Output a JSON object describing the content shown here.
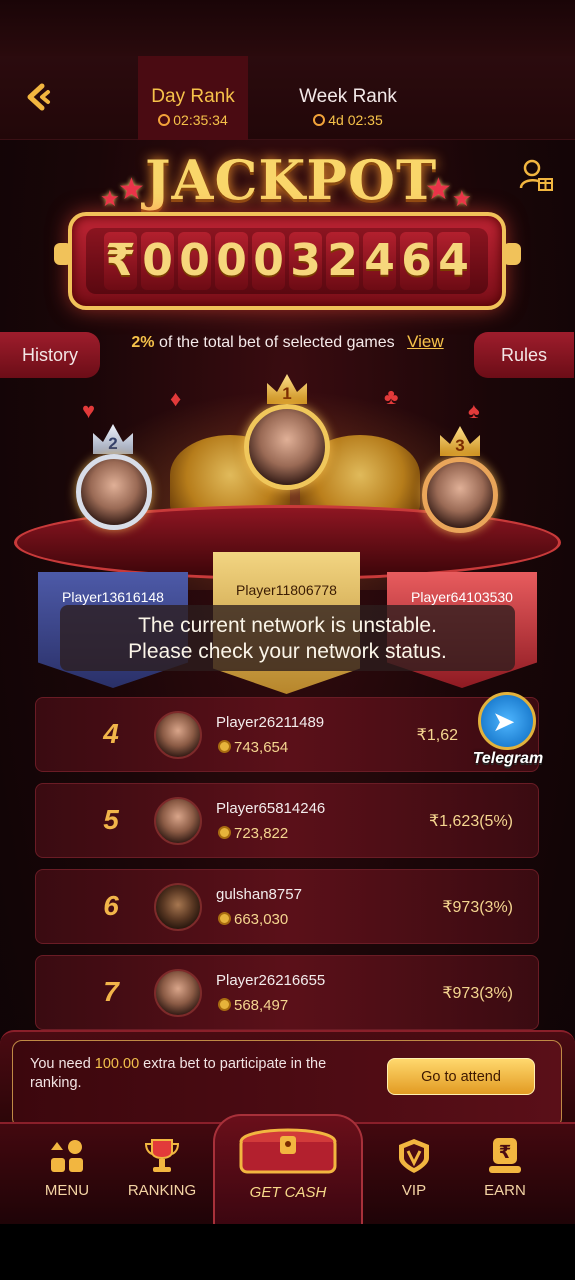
{
  "header": {
    "tabs": [
      {
        "label": "Day Rank",
        "timer": "02:35:34"
      },
      {
        "label": "Week Rank",
        "timer": "4d 02:35"
      }
    ]
  },
  "jackpot": {
    "title": "JACKPOT",
    "currency": "₹",
    "digits": [
      "0",
      "0",
      "0",
      "0",
      "3",
      "2",
      "4",
      "6",
      "4"
    ],
    "pct": "2%",
    "pct_text": "of the total bet of selected games",
    "view_label": "View",
    "history_label": "History",
    "rules_label": "Rules"
  },
  "podium": {
    "first": {
      "rank": "1",
      "name": "Player11806778"
    },
    "second": {
      "rank": "2",
      "name": "Player13616148"
    },
    "third": {
      "rank": "3",
      "name": "Player64103530"
    }
  },
  "toast": {
    "line1": "The current network is unstable.",
    "line2": "Please check your network status."
  },
  "rows": [
    {
      "rank": "4",
      "name": "Player26211489",
      "score": "743,654",
      "prize": "₹1,62"
    },
    {
      "rank": "5",
      "name": "Player65814246",
      "score": "723,822",
      "prize": "₹1,623(5%)"
    },
    {
      "rank": "6",
      "name": "gulshan8757",
      "score": "663,030",
      "prize": "₹973(3%)"
    },
    {
      "rank": "7",
      "name": "Player26216655",
      "score": "568,497",
      "prize": "₹973(3%)"
    }
  ],
  "telegram": {
    "label": "Telegram"
  },
  "attend": {
    "text_pre": "You need ",
    "amount": "100.00",
    "text_post": " extra bet to participate in the ranking.",
    "button_label": "Go to attend"
  },
  "nav": {
    "menu": "MENU",
    "ranking": "RANKING",
    "getcash": "GET CASH",
    "vip": "VIP",
    "earn": "EARN"
  },
  "colors": {
    "accent_gold": "#f6c24a",
    "bg_red": "#4a0b12"
  }
}
